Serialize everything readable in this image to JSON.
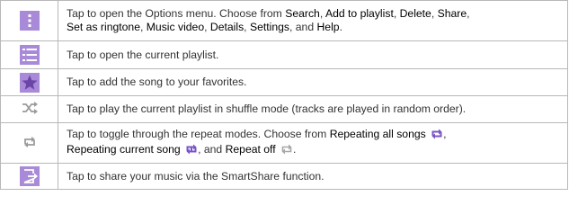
{
  "colors": {
    "accent": "#a98ad8",
    "grey_icon": "#9b9b9b",
    "border": "#b8b8b8",
    "text": "#333333"
  },
  "rows": [
    {
      "icon": "options-menu-icon",
      "pre": "Tap to open the Options menu. Choose from ",
      "items": [
        "Search",
        "Add to playlist",
        "Delete",
        "Share",
        "Set as ringtone",
        "Music video",
        "Details",
        "Settings"
      ],
      "last": "Help",
      "and": ", and ",
      "sep": ", ",
      "end": "."
    },
    {
      "icon": "playlist-icon",
      "text": "Tap to open the current playlist."
    },
    {
      "icon": "favorite-star-icon",
      "text": "Tap to add the song to your favorites."
    },
    {
      "icon": "shuffle-icon",
      "text": "Tap to play the current playlist in shuffle mode (tracks are played in random order)."
    },
    {
      "icon": "repeat-icon",
      "pre": "Tap to toggle through the repeat modes. Choose from ",
      "opt1": "Repeating all songs",
      "opt2": "Repeating current song",
      "opt3": "Repeat off",
      "sep": ", ",
      "and": ", and ",
      "end": "."
    },
    {
      "icon": "smartshare-icon",
      "text": "Tap to share your music via the SmartShare function."
    }
  ]
}
